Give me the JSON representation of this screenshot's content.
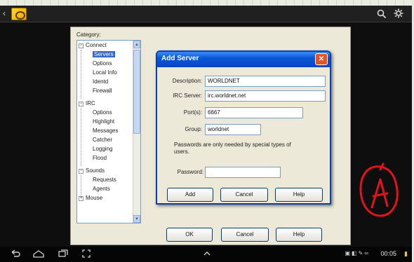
{
  "prefs": {
    "category_label": "Category:",
    "tree": [
      {
        "label": "Connect",
        "type": "parent",
        "expander": "−"
      },
      {
        "label": "Servers",
        "type": "child",
        "selected": true
      },
      {
        "label": "Options",
        "type": "child"
      },
      {
        "label": "Local Info",
        "type": "child"
      },
      {
        "label": "Identd",
        "type": "child"
      },
      {
        "label": "Firewall",
        "type": "child"
      },
      {
        "label": "IRC",
        "type": "parent",
        "expander": "−"
      },
      {
        "label": "Options",
        "type": "child"
      },
      {
        "label": "Highlight",
        "type": "child"
      },
      {
        "label": "Messages",
        "type": "child"
      },
      {
        "label": "Catcher",
        "type": "child"
      },
      {
        "label": "Logging",
        "type": "child"
      },
      {
        "label": "Flood",
        "type": "child"
      },
      {
        "label": "Sounds",
        "type": "parent",
        "expander": "−"
      },
      {
        "label": "Requests",
        "type": "child"
      },
      {
        "label": "Agents",
        "type": "child"
      },
      {
        "label": "Mouse",
        "type": "parent",
        "expander": "+"
      }
    ],
    "ok_label": "OK",
    "cancel_label": "Cancel",
    "help_label": "Help"
  },
  "add_server": {
    "title": "Add Server",
    "close_glyph": "✕",
    "description_label": "Description:",
    "description_value": "WORLDNET",
    "irc_server_label": "IRC Server:",
    "irc_server_value": "irc.worldnet.net",
    "ports_label": "Port(s):",
    "ports_value": "6667",
    "group_label": "Group:",
    "group_value": "worldnet",
    "note": "Passwords are only needed by special types of users.",
    "password_label": "Password:",
    "password_value": "",
    "add_label": "Add",
    "cancel_label": "Cancel",
    "help_label": "Help"
  },
  "statusbar": {
    "time": "00:05"
  },
  "icons": {
    "back": "back-arrow-icon",
    "logo": "app-logo-icon",
    "search": "search-icon",
    "settings": "settings-icon",
    "nav_back": "nav-back-icon",
    "nav_home": "nav-home-icon",
    "nav_recent": "nav-recent-apps-icon",
    "nav_screenshot": "nav-screenshot-icon",
    "nav_up": "nav-chevron-up-icon"
  },
  "colors": {
    "titlebar": "#0a56d8",
    "selection": "#316ac5",
    "annotation": "#e0141c"
  }
}
